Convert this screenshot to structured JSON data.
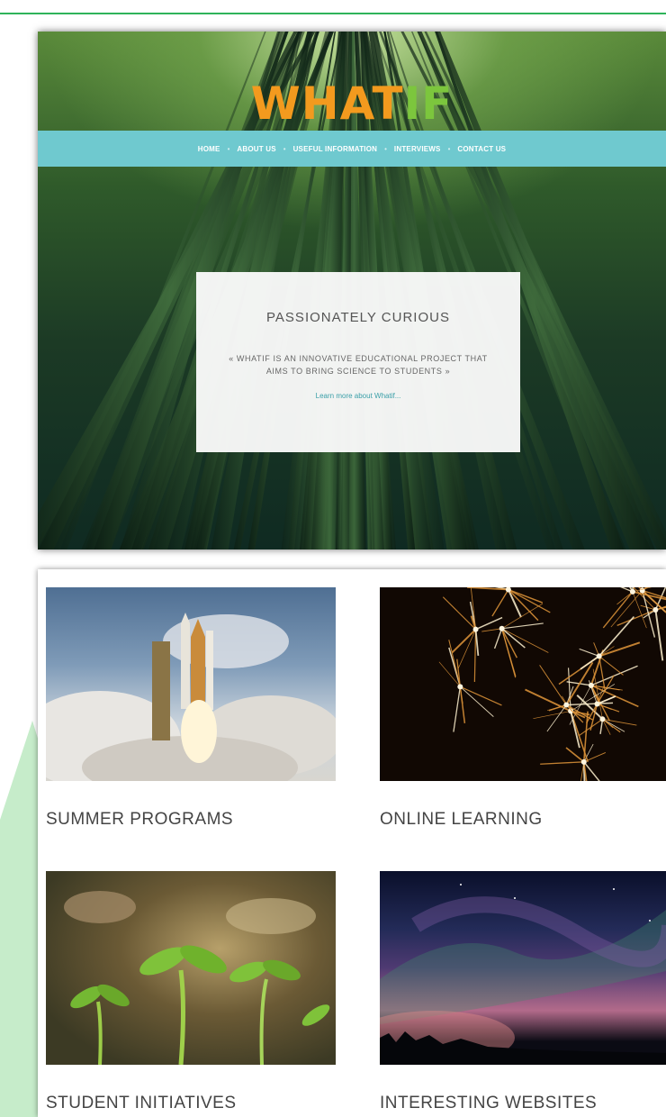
{
  "logo": {
    "part1": "WHAT",
    "part2": "IF"
  },
  "nav": {
    "items": [
      "HOME",
      "ABOUT US",
      "USEFUL INFORMATION",
      "INTERVIEWS",
      "CONTACT US"
    ],
    "separator": "•"
  },
  "hero_card": {
    "title": "PASSIONATELY CURIOUS",
    "quote": "« WHATIF IS AN INNOVATIVE EDUCATIONAL PROJECT THAT AIMS TO BRING SCIENCE TO STUDENTS »",
    "link": "Learn more about Whatif..."
  },
  "tiles": [
    {
      "caption": "SUMMER PROGRAMS"
    },
    {
      "caption": "ONLINE LEARNING"
    },
    {
      "caption": "STUDENT INITIATIVES"
    },
    {
      "caption": "INTERESTING WEBSITES"
    }
  ],
  "colors": {
    "nav_bar": "#6fc9cf",
    "logo_orange": "#f39a1e",
    "logo_green": "#7cc63d",
    "link": "#3a9fa8",
    "page_rule": "#2fb35a"
  }
}
